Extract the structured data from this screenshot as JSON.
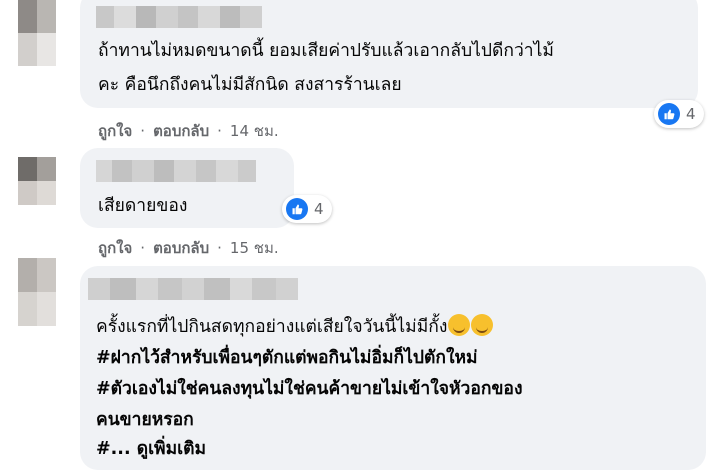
{
  "colors": {
    "bubble_bg": "#f0f2f5",
    "meta_text": "#65676b",
    "like_blue": "#1877f2"
  },
  "comments": [
    {
      "text_lines": [
        "ถ้าทานไม่หมดขนาดนี้ ยอมเสียค่าปรับแล้วเอากลับไปดีกว่าไม้",
        "คะ คือนึกถึงคนไม่มีสักนิด สงสารร้านเลย"
      ],
      "reaction_icon": "like-icon",
      "reaction_count": "4",
      "like_label": "ถูกใจ",
      "reply_label": "ตอบกลับ",
      "separator": "·",
      "time": "14 ชม."
    },
    {
      "text_lines": [
        "เสียดายของ"
      ],
      "reaction_icon": "like-icon",
      "reaction_count": "4",
      "like_label": "ถูกใจ",
      "reply_label": "ตอบกลับ",
      "separator": "·",
      "time": "15 ชม."
    },
    {
      "text_lines": [
        "ครั้งแรกที่ไปกินสดทุกอย่างแต่เสียใจวันนี้ไม่มีกั้ง",
        "#ฝากไว้สำหรับเพื่อนๆตักแต่พอกินไม่อิ่มก็ไปตักใหม่",
        "#ตัวเองไม่ใช่คนลงทุนไม่ใช่คนค้าขายไม่เข้าใจหัวอกของ",
        "คนขายหรอก"
      ],
      "emoji": [
        "laughing-crying-emoji",
        "smiling-emoji"
      ],
      "truncated_prefix": "#...",
      "see_more_label": "ดูเพิ่มเติม"
    }
  ]
}
